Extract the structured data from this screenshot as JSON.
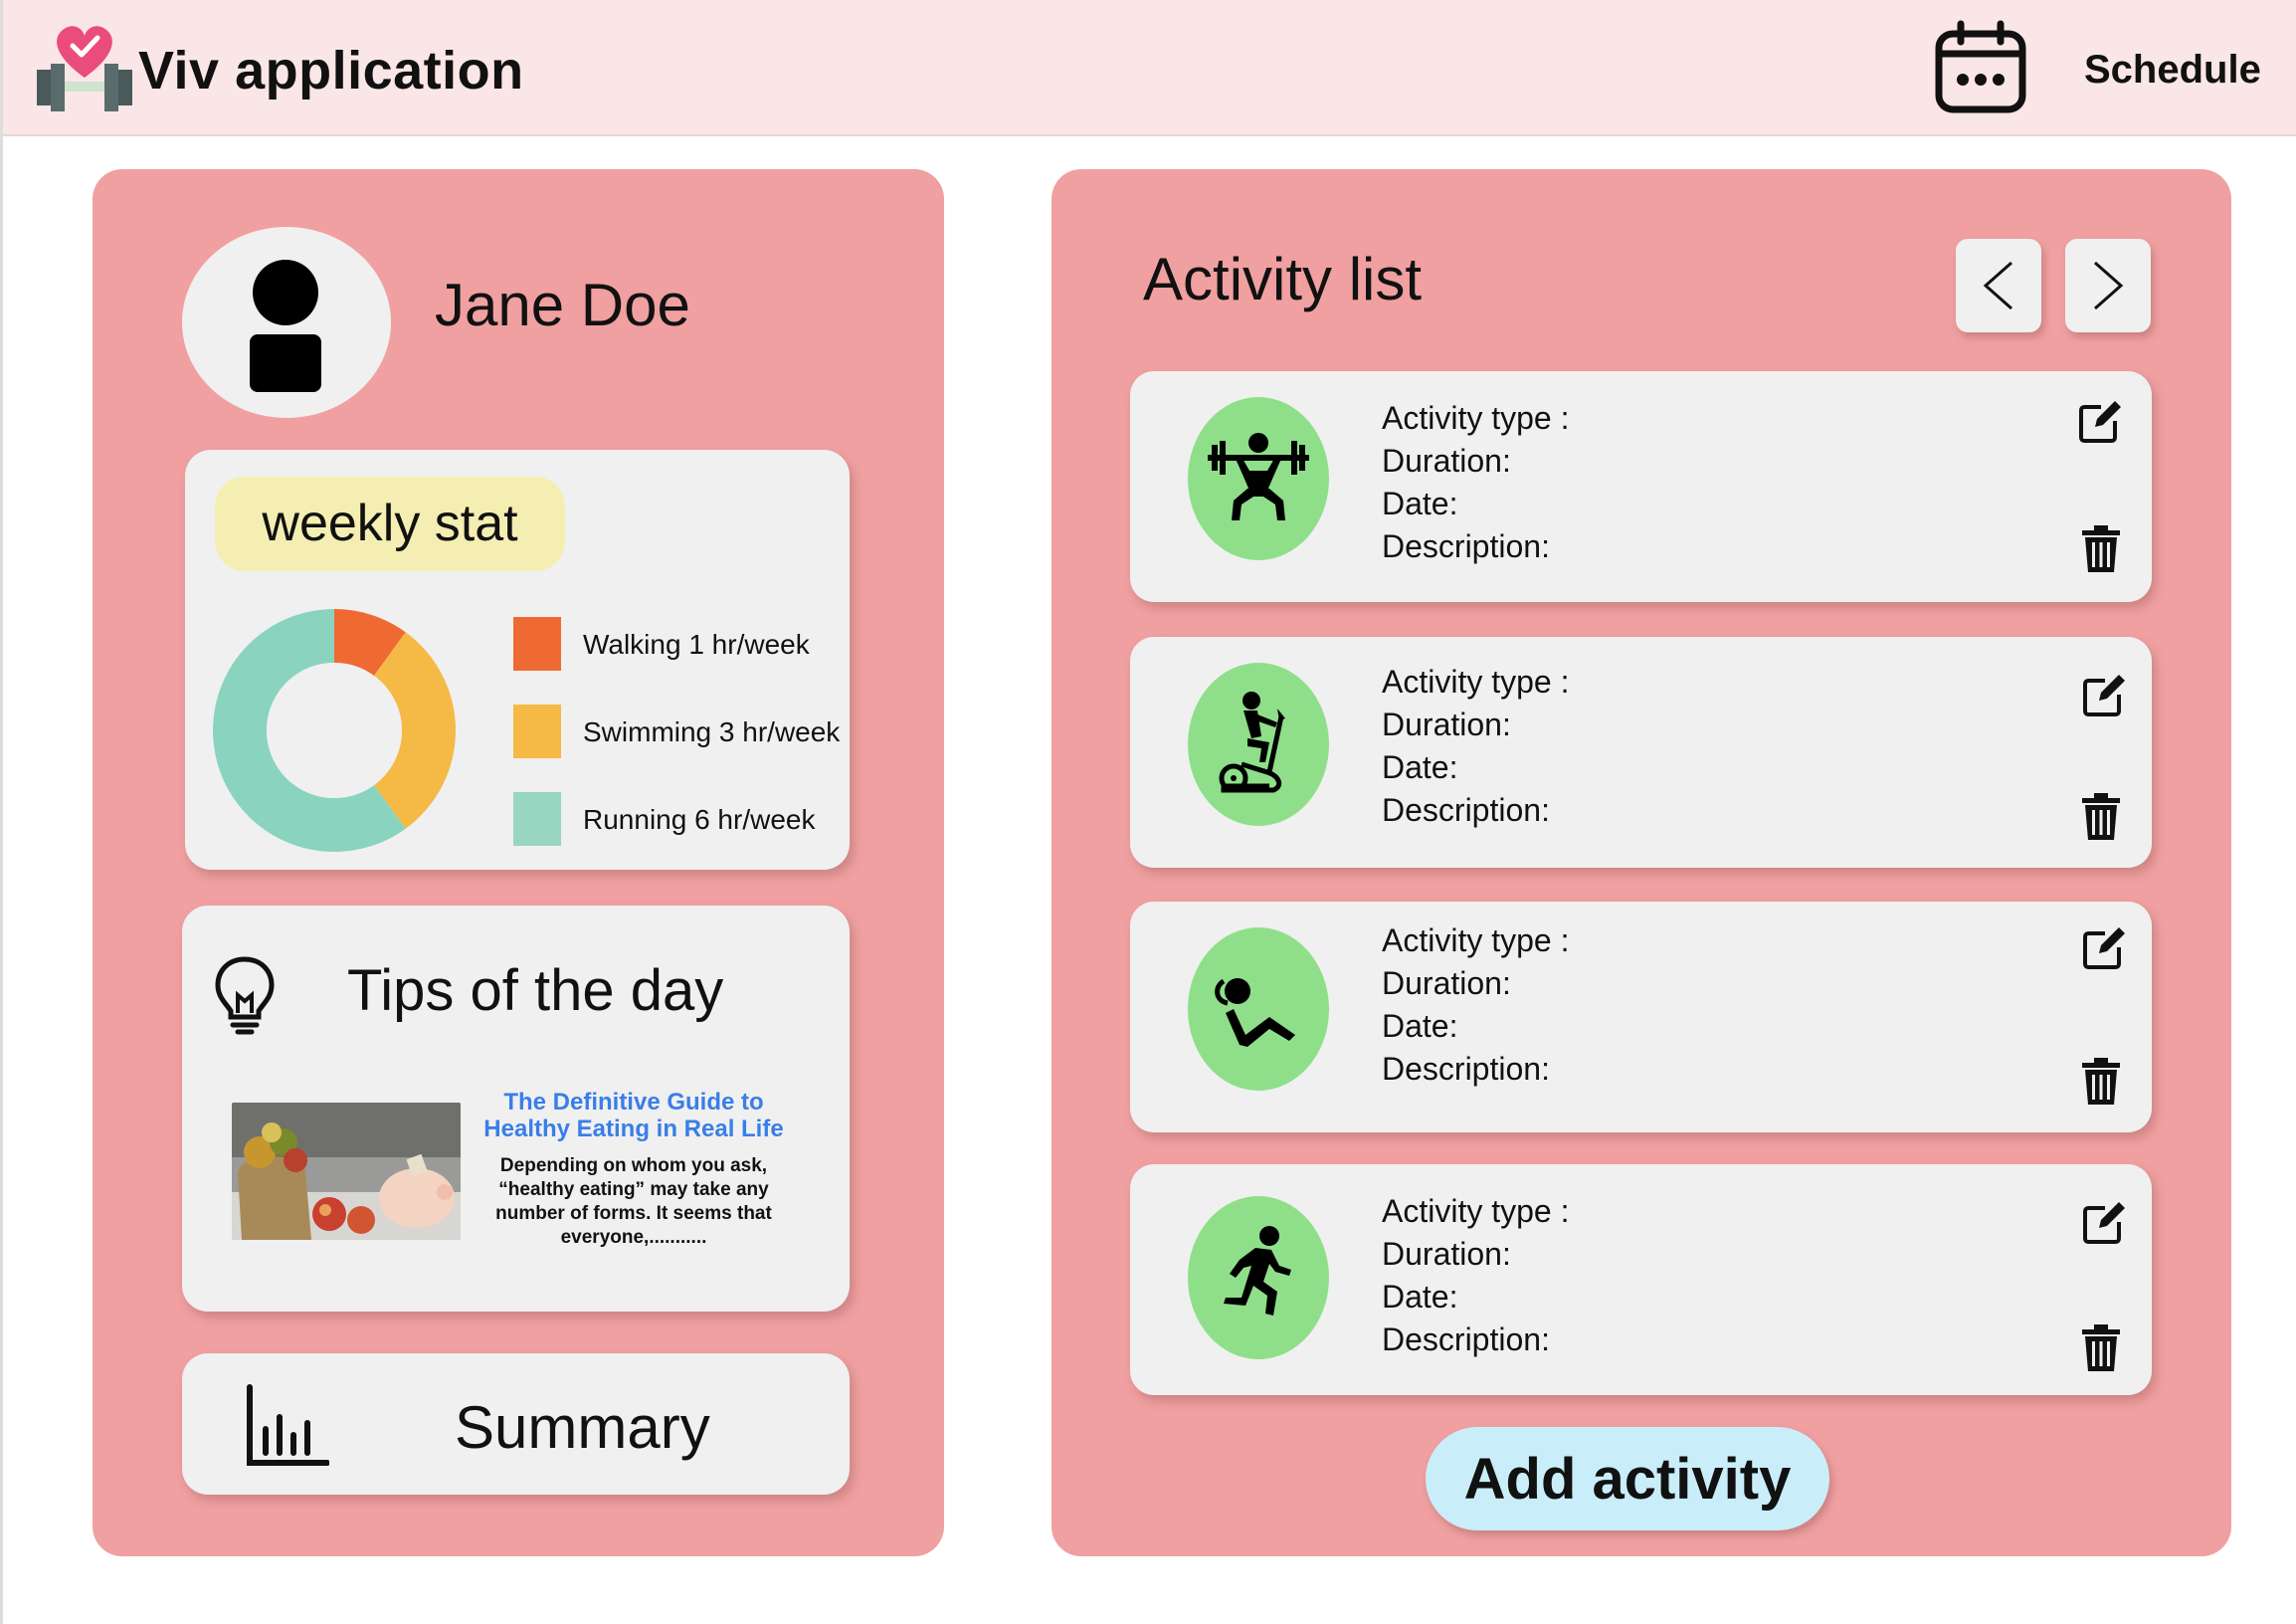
{
  "header": {
    "app_name": "Viv application",
    "logo_icon": "heart-dumbbell-logo-icon",
    "schedule_icon": "calendar-icon",
    "schedule_label": "Schedule"
  },
  "profile": {
    "avatar_icon": "user-icon",
    "name": "Jane Doe"
  },
  "weekly_stat": {
    "title": "weekly stat",
    "chart_data": {
      "type": "pie",
      "categories": [
        "Walking",
        "Swimming",
        "Running"
      ],
      "values": [
        1,
        3,
        6
      ],
      "unit": "hr/week",
      "colors": [
        "#ef6a33",
        "#f5b946",
        "#8ad4bf"
      ]
    },
    "legend": [
      {
        "label": "Walking 1 hr/week",
        "color": "#ef6a33"
      },
      {
        "label": "Swimming 3 hr/week",
        "color": "#f5b946"
      },
      {
        "label": "Running 6 hr/week",
        "color": "#98d6c1"
      }
    ]
  },
  "tips": {
    "title": "Tips of the day",
    "icon": "lightbulb-icon",
    "article": {
      "headline": "The Definitive Guide to Healthy Eating in Real Life",
      "body": "Depending on whom you ask, “healthy eating” may take any number of forms. It seems that everyone,...........",
      "image": "food-and-piggy-bank-image"
    }
  },
  "summary": {
    "label": "Summary",
    "icon": "bar-chart-icon"
  },
  "activity_list": {
    "title": "Activity list",
    "prev_icon": "chevron-left-icon",
    "next_icon": "chevron-right-icon",
    "field_labels": {
      "type": "Activity type :",
      "duration": "Duration:",
      "date": "Date:",
      "description": "Description:"
    },
    "items": [
      {
        "icon": "weightlifting-icon"
      },
      {
        "icon": "exercise-bike-icon"
      },
      {
        "icon": "sit-up-icon"
      },
      {
        "icon": "running-icon"
      }
    ],
    "edit_icon": "edit-icon",
    "delete_icon": "trash-icon",
    "add_label": "Add activity"
  },
  "colors": {
    "header_bg": "#fbe6e7",
    "panel_bg": "#f0a0a0",
    "card_bg": "#f0f0f0",
    "activity_icon_bg": "#8fdf8a",
    "add_button_bg": "#c9eefa",
    "badge_bg": "#f5eeb2",
    "link_blue": "#3a7ee8"
  }
}
